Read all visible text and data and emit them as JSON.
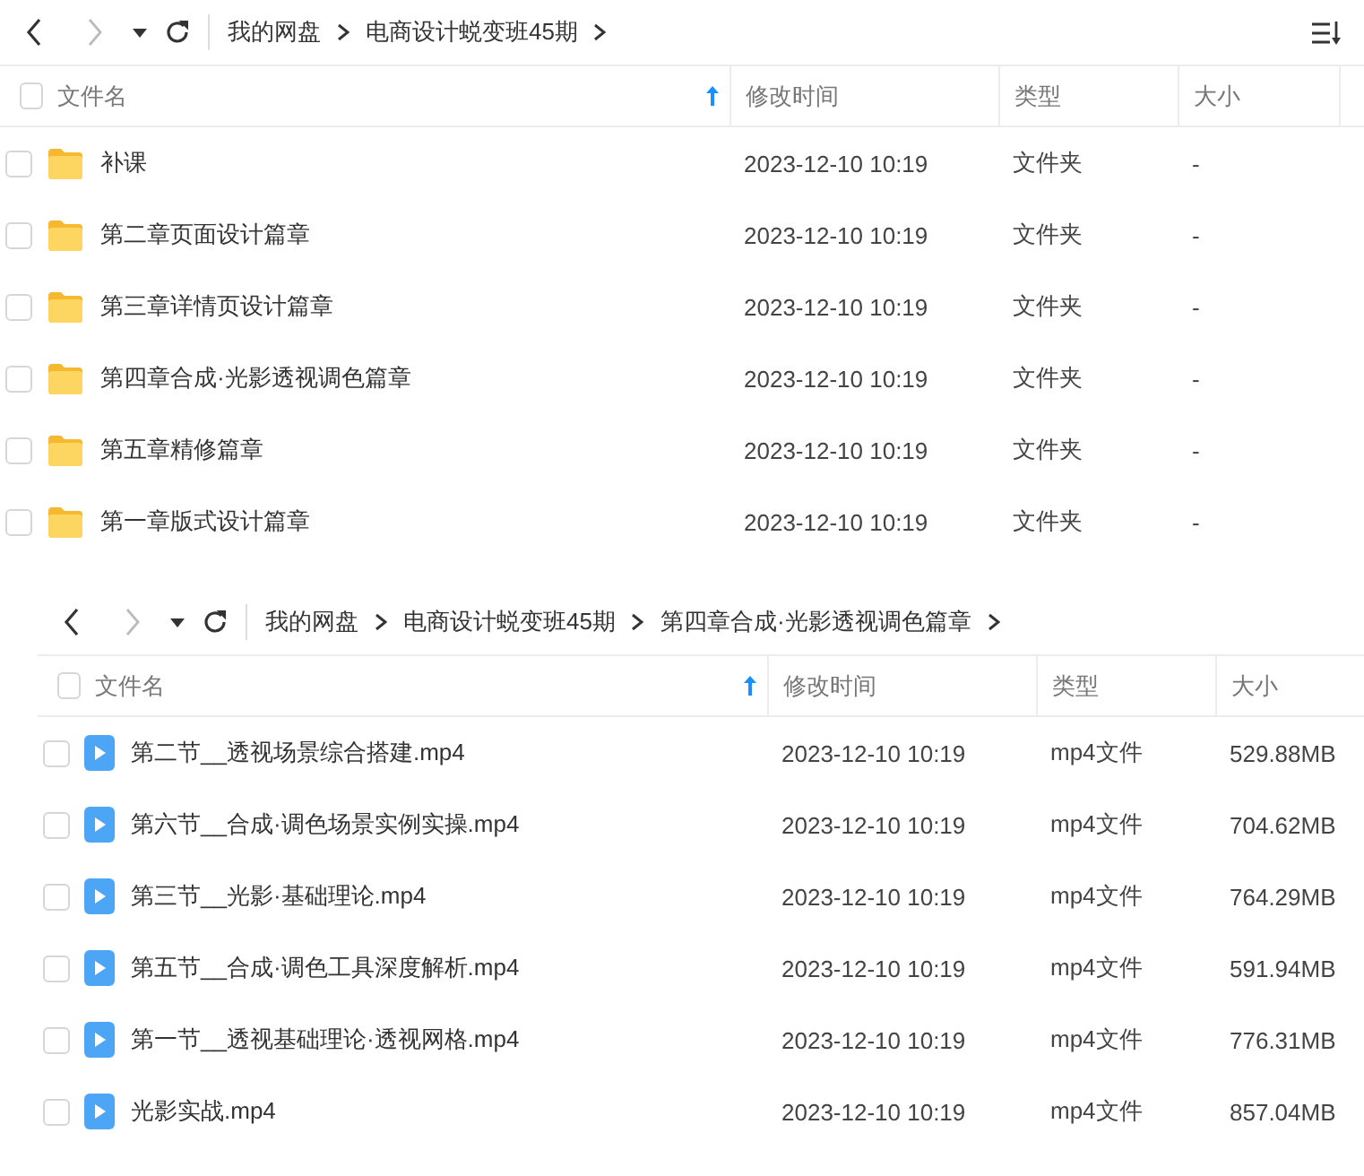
{
  "panels": [
    {
      "breadcrumb": [
        "我的网盘",
        "电商设计蜕变班45期"
      ],
      "view_menu": true,
      "columns": [
        "文件名",
        "修改时间",
        "类型",
        "大小"
      ],
      "sort_ascending": true,
      "select_all_checked": false,
      "rows": [
        {
          "kind": "folder",
          "name": "补课",
          "time": "2023-12-10 10:19",
          "type": "文件夹",
          "size": "-",
          "checked": false
        },
        {
          "kind": "folder",
          "name": "第二章页面设计篇章",
          "time": "2023-12-10 10:19",
          "type": "文件夹",
          "size": "-",
          "checked": false
        },
        {
          "kind": "folder",
          "name": "第三章详情页设计篇章",
          "time": "2023-12-10 10:19",
          "type": "文件夹",
          "size": "-",
          "checked": false
        },
        {
          "kind": "folder",
          "name": "第四章合成·光影透视调色篇章",
          "time": "2023-12-10 10:19",
          "type": "文件夹",
          "size": "-",
          "checked": false
        },
        {
          "kind": "folder",
          "name": "第五章精修篇章",
          "time": "2023-12-10 10:19",
          "type": "文件夹",
          "size": "-",
          "checked": false
        },
        {
          "kind": "folder",
          "name": "第一章版式设计篇章",
          "time": "2023-12-10 10:19",
          "type": "文件夹",
          "size": "-",
          "checked": false
        }
      ]
    },
    {
      "breadcrumb": [
        "我的网盘",
        "电商设计蜕变班45期",
        "第四章合成·光影透视调色篇章"
      ],
      "view_menu": false,
      "columns": [
        "文件名",
        "修改时间",
        "类型",
        "大小"
      ],
      "sort_ascending": true,
      "select_all_checked": false,
      "rows": [
        {
          "kind": "video",
          "name": "第二节__透视场景综合搭建.mp4",
          "time": "2023-12-10 10:19",
          "type": "mp4文件",
          "size": "529.88MB",
          "checked": false
        },
        {
          "kind": "video",
          "name": "第六节__合成·调色场景实例实操.mp4",
          "time": "2023-12-10 10:19",
          "type": "mp4文件",
          "size": "704.62MB",
          "checked": false
        },
        {
          "kind": "video",
          "name": "第三节__光影·基础理论.mp4",
          "time": "2023-12-10 10:19",
          "type": "mp4文件",
          "size": "764.29MB",
          "checked": false
        },
        {
          "kind": "video",
          "name": "第五节__合成·调色工具深度解析.mp4",
          "time": "2023-12-10 10:19",
          "type": "mp4文件",
          "size": "591.94MB",
          "checked": false
        },
        {
          "kind": "video",
          "name": "第一节__透视基础理论·透视网格.mp4",
          "time": "2023-12-10 10:19",
          "type": "mp4文件",
          "size": "776.31MB",
          "checked": false
        },
        {
          "kind": "video",
          "name": "光影实战.mp4",
          "time": "2023-12-10 10:19",
          "type": "mp4文件",
          "size": "857.04MB",
          "checked": false
        }
      ]
    }
  ]
}
